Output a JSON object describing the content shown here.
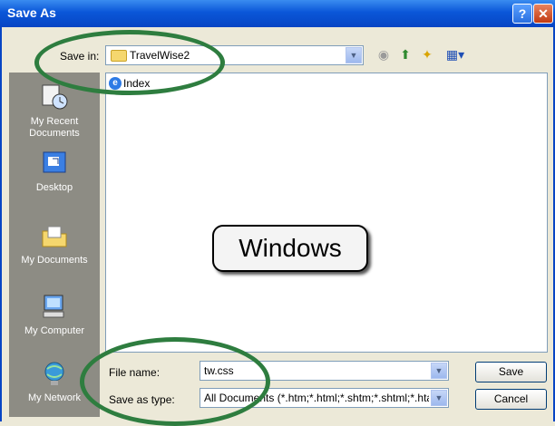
{
  "window": {
    "title": "Save As",
    "help_glyph": "?",
    "close_glyph": "✕"
  },
  "savein": {
    "label": "Save in:",
    "value": "TravelWise2"
  },
  "toolbar": {
    "back_glyph": "◉",
    "up_glyph": "⬆",
    "newfolder_glyph": "✦",
    "views_glyph": "▦▾"
  },
  "places": [
    {
      "label": "My Recent Documents"
    },
    {
      "label": "Desktop"
    },
    {
      "label": "My Documents"
    },
    {
      "label": "My Computer"
    },
    {
      "label": "My Network"
    }
  ],
  "files": [
    {
      "name": "Index"
    }
  ],
  "callout": {
    "text": "Windows"
  },
  "filename": {
    "label": "File name:",
    "value": "tw.css"
  },
  "savetype": {
    "label": "Save as type:",
    "value": "All Documents (*.htm;*.html;*.shtm;*.shtml;*.hta;"
  },
  "buttons": {
    "save": "Save",
    "cancel": "Cancel"
  },
  "dropdown_glyph": "▼",
  "colors": {
    "titlebar": "#0a56d8",
    "dialog": "#ece9d8",
    "places": "#8d8c84",
    "ellipse": "#2e7d3f"
  }
}
